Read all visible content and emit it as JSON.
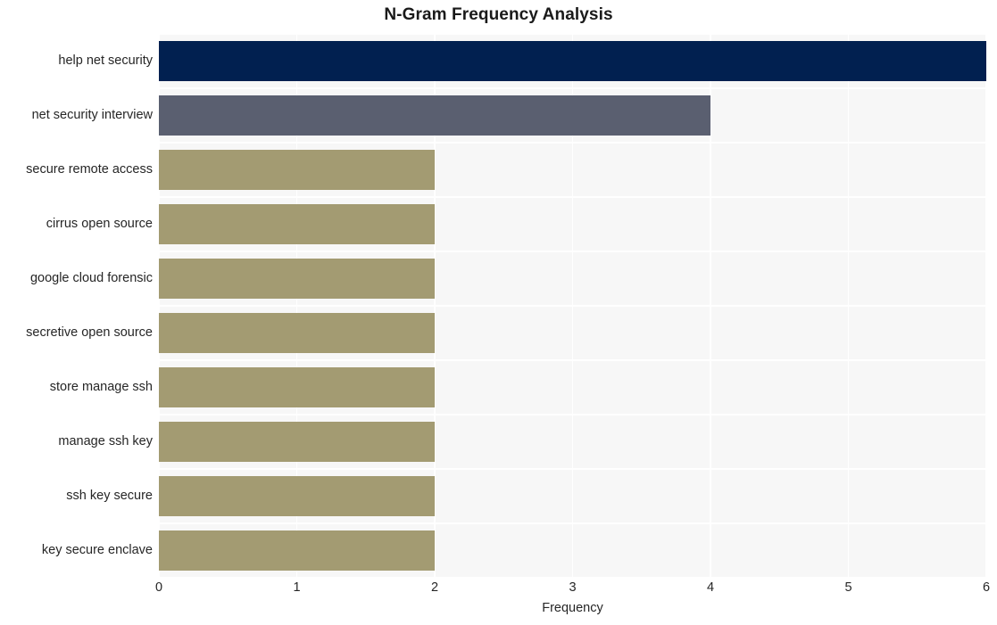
{
  "chart_data": {
    "type": "bar",
    "orientation": "horizontal",
    "title": "N-Gram Frequency Analysis",
    "xlabel": "Frequency",
    "ylabel": "",
    "categories": [
      "help net security",
      "net security interview",
      "secure remote access",
      "cirrus open source",
      "google cloud forensic",
      "secretive open source",
      "store manage ssh",
      "manage ssh key",
      "ssh key secure",
      "key secure enclave"
    ],
    "values": [
      6,
      4,
      2,
      2,
      2,
      2,
      2,
      2,
      2,
      2
    ],
    "bar_colors": [
      "#012050",
      "#5a5f70",
      "#a39b72",
      "#a39b72",
      "#a39b72",
      "#a39b72",
      "#a39b72",
      "#a39b72",
      "#a39b72",
      "#a39b72"
    ],
    "xlim": [
      0,
      6
    ],
    "xticks": [
      0,
      1,
      2,
      3,
      4,
      5,
      6
    ],
    "xtick_labels": [
      "0",
      "1",
      "2",
      "3",
      "4",
      "5",
      "6"
    ],
    "grid": true,
    "grid_color": "#ffffff",
    "plot_background": "#f7f7f7",
    "figure_background": "#ffffff",
    "legend": null
  }
}
